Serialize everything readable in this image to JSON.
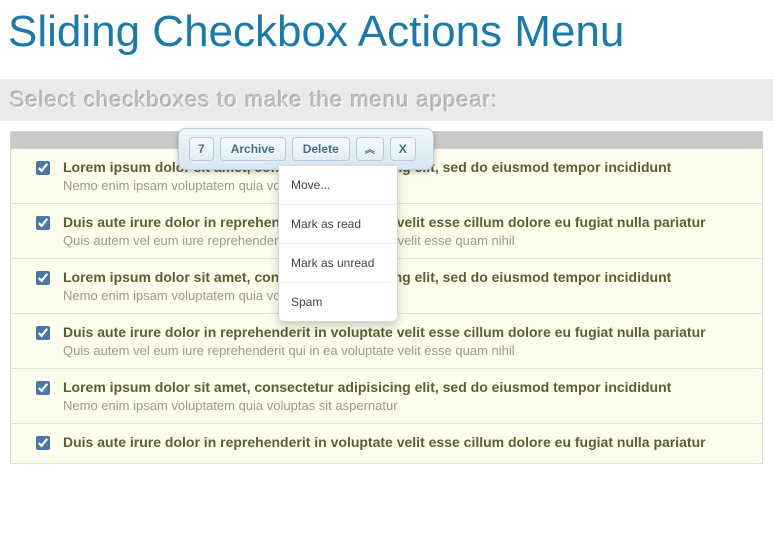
{
  "page": {
    "title": "Sliding Checkbox Actions Menu",
    "instruction": "Select checkboxes to make the menu appear:"
  },
  "actionMenu": {
    "count": "7",
    "archive": "Archive",
    "delete": "Delete",
    "collapseHint": "collapse",
    "close": "X",
    "dropdown": {
      "move": "Move...",
      "read": "Mark as read",
      "unread": "Mark as unread",
      "spam": "Spam"
    }
  },
  "rows": [
    {
      "checked": true,
      "title": "Lorem ipsum dolor sit amet, consectetur adipisicing elit, sed do eiusmod tempor incididunt",
      "sub": "Nemo enim ipsam voluptatem quia voluptas sit aspernatur"
    },
    {
      "checked": true,
      "title": "Duis aute irure dolor in reprehenderit in voluptate velit esse cillum dolore eu fugiat nulla pariatur",
      "sub": "Quis autem vel eum iure reprehenderit qui in ea voluptate velit esse quam nihil"
    },
    {
      "checked": true,
      "title": "Lorem ipsum dolor sit amet, consectetur adipisicing elit, sed do eiusmod tempor incididunt",
      "sub": "Nemo enim ipsam voluptatem quia voluptas sit aspernatur"
    },
    {
      "checked": true,
      "title": "Duis aute irure dolor in reprehenderit in voluptate velit esse cillum dolore eu fugiat nulla pariatur",
      "sub": "Quis autem vel eum iure reprehenderit qui in ea voluptate velit esse quam nihil"
    },
    {
      "checked": true,
      "title": "Lorem ipsum dolor sit amet, consectetur adipisicing elit, sed do eiusmod tempor incididunt",
      "sub": "Nemo enim ipsam voluptatem quia voluptas sit aspernatur"
    },
    {
      "checked": true,
      "title": "Duis aute irure dolor in reprehenderit in voluptate velit esse cillum dolore eu fugiat nulla pariatur",
      "sub": ""
    }
  ]
}
